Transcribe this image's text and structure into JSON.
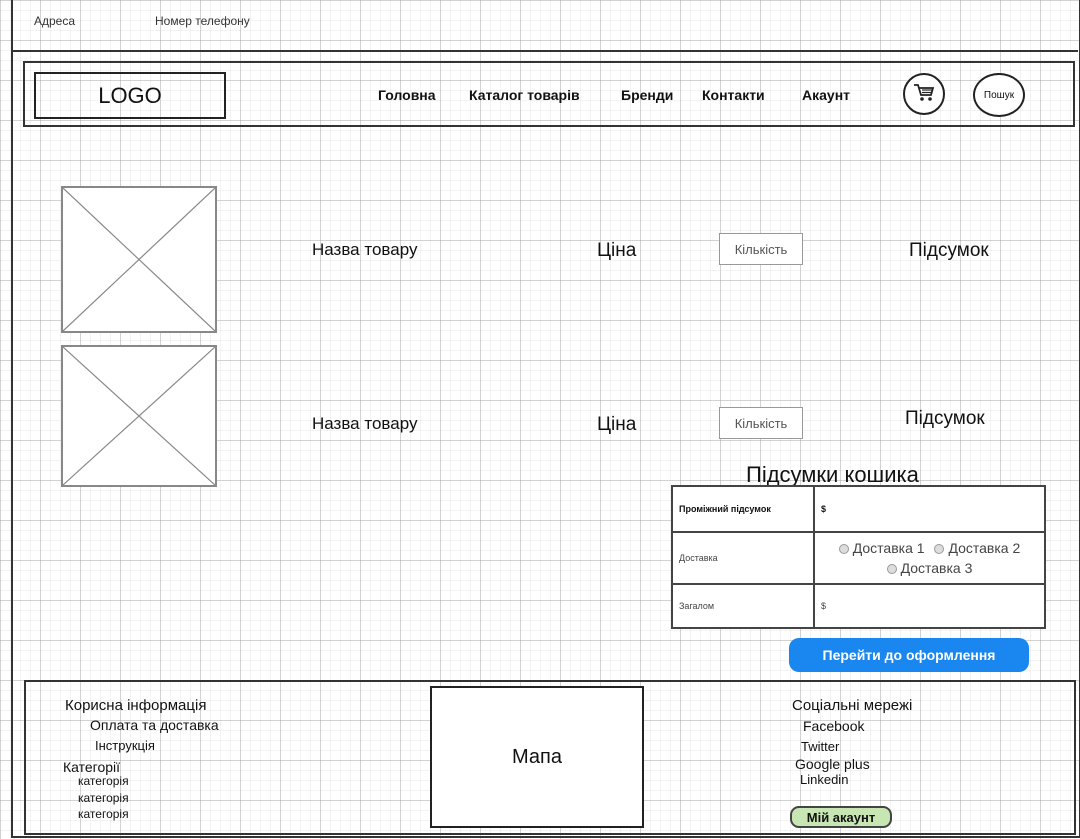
{
  "topbar": {
    "address": "Адреса",
    "phone": "Номер телефону"
  },
  "header": {
    "logo": "LOGO",
    "nav": [
      "Головна",
      "Каталог товарів",
      "Бренди",
      "Контакти",
      "Акаунт"
    ],
    "search": "Пошук"
  },
  "products": [
    {
      "name": "Назва товару",
      "price": "Ціна",
      "qty": "Кількість",
      "subtotal": "Підсумок"
    },
    {
      "name": "Назва товару",
      "price": "Ціна",
      "qty": "Кількість",
      "subtotal": "Підсумок"
    }
  ],
  "cart_totals": {
    "title": "Підсумки кошика",
    "subtotal_label": "Проміжний підсумок",
    "subtotal_value": "$",
    "shipping_label": "Доставка",
    "shipping_options": [
      "Доставка 1",
      "Доставка 2",
      "Доставка 3"
    ],
    "total_label": "Загалом",
    "total_value": "$"
  },
  "checkout_button": "Перейти до оформлення",
  "footer": {
    "info_title": "Корисна інформація",
    "info_links": [
      "Оплата та доставка",
      "Інструкція"
    ],
    "categories_title": "Категорії",
    "categories": [
      "категорія",
      "категорія",
      "категорія"
    ],
    "map": "Мапа",
    "social_title": "Соціальні мережі",
    "social_links": [
      "Facebook",
      "Twitter",
      "Google plus",
      "Linkedin"
    ],
    "my_account": "Мій акаунт"
  },
  "icons": {
    "cart": "cart-icon",
    "image_placeholder": "image-placeholder-icon"
  }
}
